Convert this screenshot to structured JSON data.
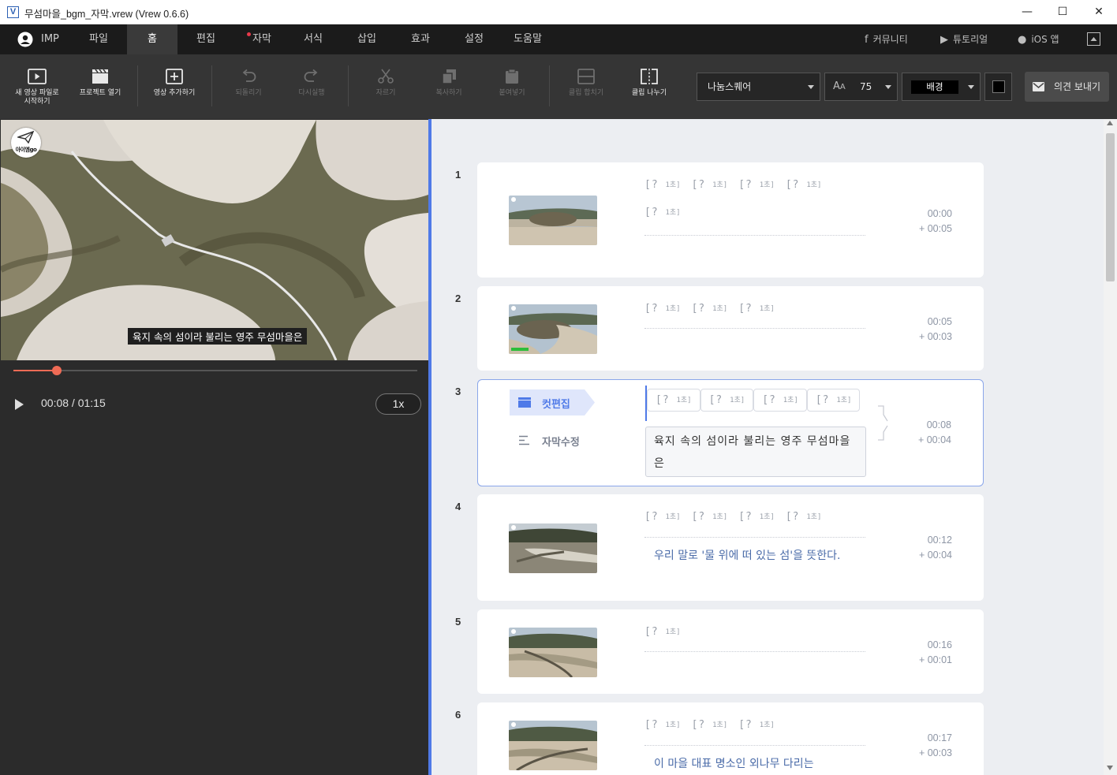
{
  "window": {
    "title": "무섬마을_bgm_자막.vrew (Vrew 0.6.6)",
    "app_icon": "V",
    "minimize": "—",
    "maximize": "☐",
    "close": "✕"
  },
  "menu": {
    "user": "IMP",
    "tabs": [
      "파일",
      "홈",
      "편집",
      "자막",
      "서식",
      "삽입",
      "효과",
      "설정",
      "도움말"
    ],
    "active_tab": "홈",
    "right_links": [
      "커뮤니티",
      "튜토리얼",
      "iOS 앱"
    ]
  },
  "toolbar": {
    "new_video_line1": "새 영상 파일로",
    "new_video_line2": "시작하기",
    "open_project": "프로젝트 열기",
    "add_video": "영상 추가하기",
    "undo": "되돌리기",
    "redo": "다시실행",
    "cut": "자르기",
    "copy": "복사하기",
    "paste": "붙여넣기",
    "merge_clip": "클립 합치기",
    "split_clip": "클립 나누기",
    "font": "나눔스퀘어",
    "font_size": "75",
    "background": "배경",
    "feedback": "의견 보내기"
  },
  "player": {
    "subtitle": "육지 속의 섬이라 불리는 영주 무섬마을은",
    "time": "00:08 / 01:15",
    "speed": "1x",
    "progress": 0.107,
    "logo_text": "아이엠go"
  },
  "clips": [
    {
      "num": "1",
      "words": [
        "[?",
        "[?",
        "[?",
        "[?",
        "[?"
      ],
      "unit": "1초]",
      "text": "",
      "start": "00:00",
      "dur": "+ 00:05"
    },
    {
      "num": "2",
      "words": [
        "[?",
        "[?",
        "[?"
      ],
      "unit": "1초]",
      "text": "",
      "start": "00:05",
      "dur": "+ 00:03"
    },
    {
      "num": "3",
      "words": [
        "[?",
        "[?",
        "[?",
        "[?"
      ],
      "unit": "1초]",
      "text": "육지 속의 섬이라 불리는 영주 무섬마을은",
      "start": "00:08",
      "dur": "+ 00:04",
      "cut_edit": "컷편집",
      "subtitle_edit": "자막수정"
    },
    {
      "num": "4",
      "words": [
        "[?",
        "[?",
        "[?",
        "[?"
      ],
      "unit": "1초]",
      "text": "우리 말로 '물 위에 떠 있는 섬'을 뜻한다.",
      "start": "00:12",
      "dur": "+ 00:04"
    },
    {
      "num": "5",
      "words": [
        "[?"
      ],
      "unit": "1초]",
      "text": "",
      "start": "00:16",
      "dur": "+ 00:01"
    },
    {
      "num": "6",
      "words": [
        "[?",
        "[?",
        "[?"
      ],
      "unit": "1초]",
      "text": "이 마을 대표 명소인 외나무 다리는",
      "start": "00:17",
      "dur": "+ 00:03"
    }
  ],
  "colors": {
    "accent": "#4f7ae8",
    "seek": "#ef6b55",
    "menubar": "#1b1b1b",
    "toolbar": "#353535",
    "editor_bg": "#eceef2",
    "subtitle_text": "#4a6ba8"
  }
}
